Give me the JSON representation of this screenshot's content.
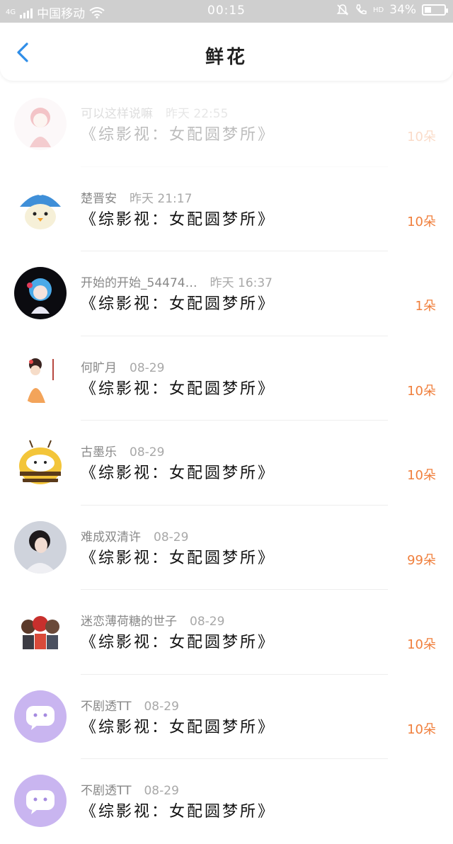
{
  "status_bar": {
    "signal_label": "4G",
    "carrier": "中国移动",
    "time": "00:15",
    "hd_label": "HD",
    "battery": "34%",
    "battery_level": 0.34
  },
  "header": {
    "title": "鲜花",
    "back_icon": "chevron-left-icon"
  },
  "colors": {
    "accent_blue": "#2f8ee8",
    "count_orange": "#f07f3c"
  },
  "items": [
    {
      "name": "可以这样说嘛",
      "time": "昨天 22:55",
      "title": "《综影视：女配圆梦所》",
      "count": "10朵"
    },
    {
      "name": "楚晋安",
      "time": "昨天 21:17",
      "title": "《综影视：女配圆梦所》",
      "count": "10朵"
    },
    {
      "name": "开始的开始_54474…",
      "time": "昨天 16:37",
      "title": "《综影视：女配圆梦所》",
      "count": "1朵"
    },
    {
      "name": "何旷月",
      "time": "08-29",
      "title": "《综影视：女配圆梦所》",
      "count": "10朵"
    },
    {
      "name": "古墨乐",
      "time": "08-29",
      "title": "《综影视：女配圆梦所》",
      "count": "10朵"
    },
    {
      "name": "难成双清许",
      "time": "08-29",
      "title": "《综影视：女配圆梦所》",
      "count": "99朵"
    },
    {
      "name": "迷恋薄荷糖的世子",
      "time": "08-29",
      "title": "《综影视：女配圆梦所》",
      "count": "10朵"
    },
    {
      "name": "不剧透TT",
      "time": "08-29",
      "title": "《综影视：女配圆梦所》",
      "count": "10朵"
    },
    {
      "name": "不剧透TT",
      "time": "08-29",
      "title": "《综影视：女配圆梦所》",
      "count": ""
    }
  ]
}
